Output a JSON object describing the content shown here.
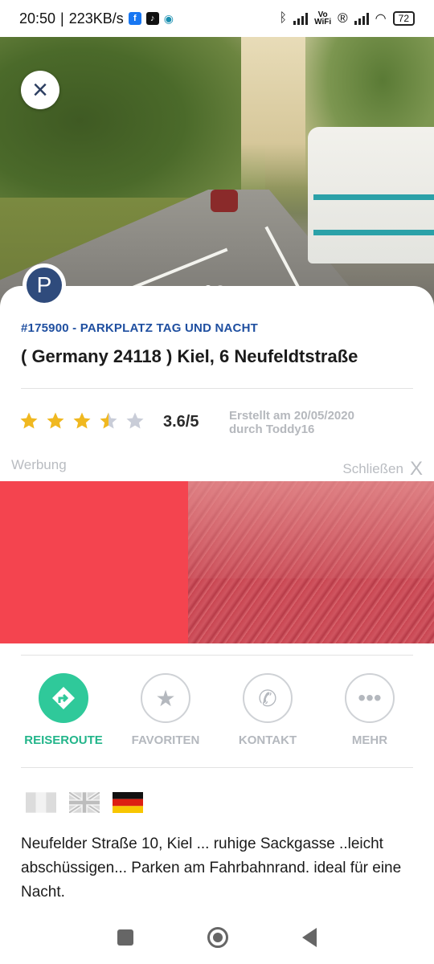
{
  "status_bar": {
    "time": "20:50",
    "speed": "223KB/s",
    "battery": "72",
    "icons": [
      "facebook-icon",
      "tiktok-icon",
      "location-icon",
      "bluetooth-icon",
      "signal-icon",
      "vowifi-icon",
      "registered-icon",
      "wifi-icon",
      "battery-icon"
    ],
    "vowifi_label": "Vo\nWiFi"
  },
  "hero": {
    "close_icon": "×",
    "image_count": 2,
    "active_image": 1
  },
  "place": {
    "badge_letter": "P",
    "id_line": "#175900 - PARKPLATZ TAG UND NACHT",
    "title": "( Germany 24118 ) Kiel, 6 Neufeldtstraße",
    "rating_value": 3.6,
    "rating_text": "3.6/5",
    "created_line1": "Erstellt am 20/05/2020",
    "created_line2": "durch Toddy16"
  },
  "ad": {
    "label": "Werbung",
    "close_label": "Schließen",
    "close_icon": "X"
  },
  "actions": [
    {
      "label": "REISEROUTE",
      "icon": "route-icon",
      "primary": true
    },
    {
      "label": "FAVORITEN",
      "icon": "star-icon",
      "primary": false
    },
    {
      "label": "KONTAKT",
      "icon": "phone-icon",
      "primary": false
    },
    {
      "label": "MEHR",
      "icon": "more-icon",
      "primary": false
    }
  ],
  "languages": [
    "italian-flag",
    "uk-flag",
    "german-flag"
  ],
  "description": "Neufelder Straße 10, Kiel ... ruhige Sackgasse ..leicht abschüssigen... Parken am Fahrbahnrand. ideal für eine Nacht.",
  "colors": {
    "brand_blue": "#2f4b7c",
    "id_blue": "#1f4fa0",
    "accent_green": "#2fc99a",
    "star_gold": "#f0b820",
    "star_grey": "#c9cdd8",
    "ad_red": "#f4444f"
  }
}
